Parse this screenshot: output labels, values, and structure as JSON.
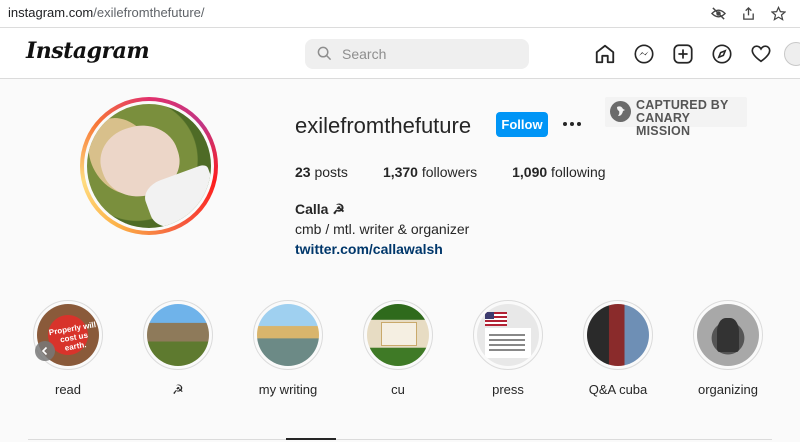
{
  "browser": {
    "url_domain": "instagram.com",
    "url_path": "/exilefromthefuture/",
    "icons": [
      "eye-off-icon",
      "share-icon",
      "star-icon"
    ]
  },
  "header": {
    "logo": "Instagram",
    "search_placeholder": "Search",
    "nav_icons": [
      "home-icon",
      "messenger-icon",
      "new-post-icon",
      "explore-icon",
      "heart-icon",
      "profile-avatar"
    ]
  },
  "profile": {
    "username": "exilefromthefuture",
    "follow_label": "Follow",
    "more_label": "•••",
    "posts_count": "23",
    "posts_label": " posts",
    "followers_count": "1,370",
    "followers_label": " followers",
    "following_count": "1,090",
    "following_label": " following",
    "bio_name": "Calla ☭",
    "bio_text": "cmb / mtl. writer & organizer",
    "bio_link": "twitter.com/callawalsh"
  },
  "watermark": {
    "line1": "CAPTURED BY",
    "line2": "CANARY MISSION"
  },
  "highlights": [
    {
      "label": "read",
      "image_text": "Properly will cost us earth."
    },
    {
      "label": "☭"
    },
    {
      "label": "my writing"
    },
    {
      "label": "cu"
    },
    {
      "label": "press"
    },
    {
      "label": "Q&A cuba"
    },
    {
      "label": "organizing"
    }
  ],
  "colors": {
    "accent": "#0095f6",
    "link": "#00376b",
    "text": "#262626",
    "background": "#fafafa"
  }
}
